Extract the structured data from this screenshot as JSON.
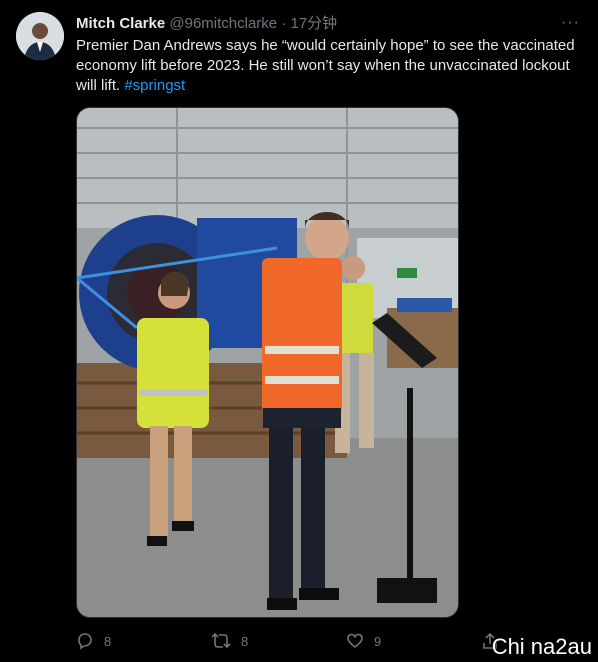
{
  "tweet": {
    "author_name": "Mitch Clarke",
    "author_handle": "@96mitchclarke",
    "separator": "·",
    "time": "17分钟",
    "more_label": "···",
    "text_main": "Premier Dan Andrews says he “would certainly hope” to see the vaccinated economy lift before 2023. He still won’t say when the unvaccinated lockout will lift.",
    "hashtag": "#springst"
  },
  "actions": {
    "reply_count": "8",
    "retweet_count": "8",
    "like_count": "9"
  },
  "icons": {
    "reply": "reply-icon",
    "retweet": "retweet-icon",
    "like": "heart-icon",
    "share": "share-icon",
    "more": "more-icon"
  },
  "watermark": "Chi na2au",
  "colors": {
    "background": "#000000",
    "text": "#e7e9ea",
    "muted": "#71767b",
    "link": "#1d9bf0"
  }
}
